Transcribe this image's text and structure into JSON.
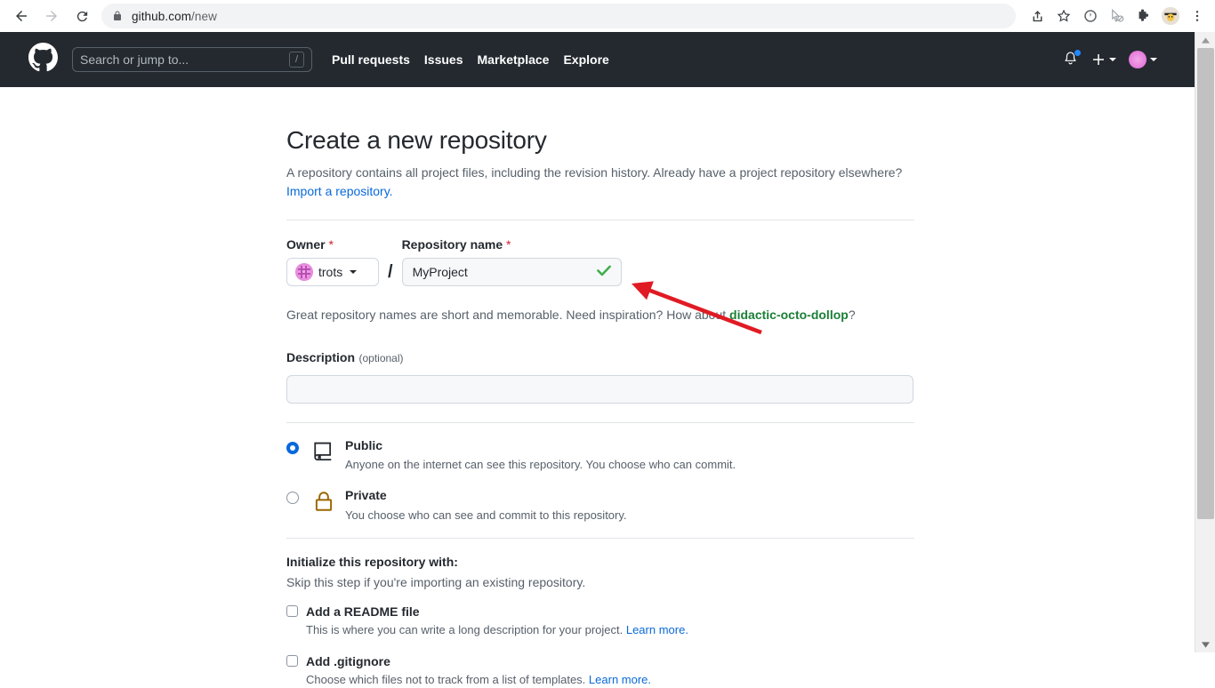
{
  "browser": {
    "back_icon": "back-arrow-icon",
    "forward_icon": "forward-arrow-icon",
    "reload_icon": "reload-icon",
    "lock_icon": "lock-icon",
    "url_domain": "github.com",
    "url_path": "/new",
    "toolbar_icons": [
      "share-icon",
      "bookmark-star-icon",
      "extension-globe-icon",
      "cursor-block-icon",
      "puzzle-extensions-icon",
      "profile-avatar-icon",
      "three-dot-menu-icon"
    ]
  },
  "gh_header": {
    "logo_icon": "github-mark-icon",
    "search_placeholder": "Search or jump to...",
    "search_shortcut": "/",
    "nav": [
      {
        "label": "Pull requests"
      },
      {
        "label": "Issues"
      },
      {
        "label": "Marketplace"
      },
      {
        "label": "Explore"
      }
    ],
    "bell_icon": "notification-bell-icon",
    "has_notification_dot": true,
    "plus_icon": "plus-icon",
    "user_avatar_icon": "user-avatar-icon"
  },
  "page": {
    "title": "Create a new repository",
    "subtitle": "A repository contains all project files, including the revision history. Already have a project repository elsewhere?",
    "import_link": "Import a repository."
  },
  "owner_field": {
    "label": "Owner",
    "required_mark": "*",
    "owner_name": "trots",
    "avatar_icon": "owner-avatar-icon",
    "separator": "/"
  },
  "repo_field": {
    "label": "Repository name",
    "required_mark": "*",
    "value": "MyProject",
    "valid_icon": "green-check-icon",
    "hint_prefix": "Great repository names are short and memorable. Need inspiration? How about ",
    "hint_suggestion": "didactic-octo-dollop",
    "hint_suffix": "?"
  },
  "description_field": {
    "label": "Description",
    "optional_text": "(optional)",
    "value": "",
    "placeholder": ""
  },
  "visibility": {
    "options": [
      {
        "id": "public",
        "title": "Public",
        "description": "Anyone on the internet can see this repository. You choose who can commit.",
        "icon": "repo-book-icon",
        "selected": true
      },
      {
        "id": "private",
        "title": "Private",
        "description": "You choose who can see and commit to this repository.",
        "icon": "lock-icon",
        "selected": false
      }
    ]
  },
  "initialize": {
    "title": "Initialize this repository with:",
    "subtitle": "Skip this step if you're importing an existing repository.",
    "items": [
      {
        "label": "Add a README file",
        "description": "This is where you can write a long description for your project. ",
        "learn_more": "Learn more.",
        "checked": false
      },
      {
        "label": "Add .gitignore",
        "description": "Choose which files not to track from a list of templates. ",
        "learn_more": "Learn more.",
        "checked": false
      }
    ]
  },
  "annotation": {
    "type": "red-arrow",
    "color": "#e01b24",
    "points_to": "repository-name-input"
  },
  "colors": {
    "header_bg": "#24292f",
    "accent_blue": "#0969da",
    "suggestion_green": "#1a7f37",
    "required_red": "#cf222e",
    "lock_gold": "#9a6700"
  },
  "scrollbar": {
    "up_arrow_icon": "scroll-up-arrow-icon",
    "down_arrow_icon": "scroll-down-arrow-icon"
  }
}
